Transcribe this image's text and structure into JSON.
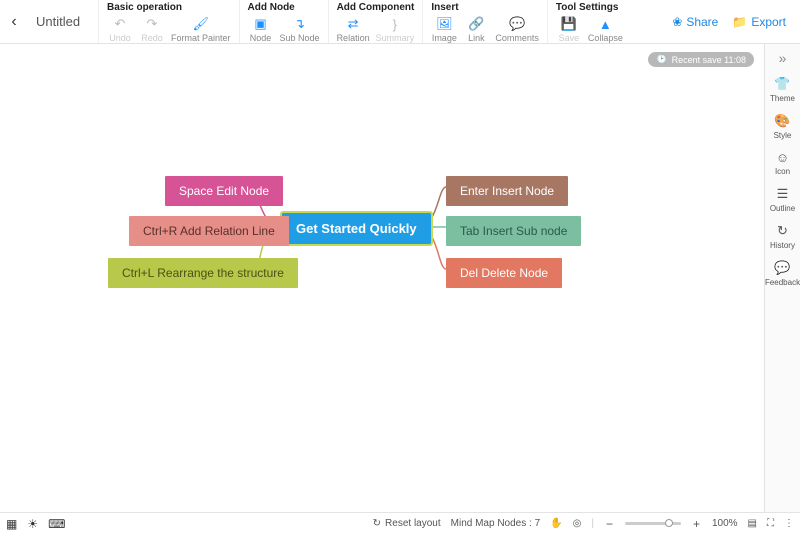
{
  "app": {
    "title": "Untitled"
  },
  "toolbar": {
    "groups": {
      "basic": {
        "label": "Basic operation",
        "undo": "Undo",
        "redo": "Redo",
        "fmt": "Format Painter"
      },
      "addnode": {
        "label": "Add Node",
        "node": "Node",
        "subnode": "Sub Node"
      },
      "addcomp": {
        "label": "Add Component",
        "relation": "Relation",
        "summary": "Summary"
      },
      "insert": {
        "label": "Insert",
        "image": "Image",
        "link": "Link",
        "comments": "Comments"
      },
      "toolset": {
        "label": "Tool Settings",
        "save": "Save",
        "collapse": "Collapse"
      }
    },
    "share": "Share",
    "export": "Export"
  },
  "savebadge": "Recent save 11:08",
  "sidebar": {
    "theme": "Theme",
    "style": "Style",
    "icon": "Icon",
    "outline": "Outline",
    "history": "History",
    "feedback": "Feedback"
  },
  "bottom": {
    "reset": "Reset layout",
    "nodes_label": "Mind Map Nodes :",
    "nodes_count": "7",
    "zoom": "100%"
  },
  "mindmap": {
    "center": "Get Started Quickly",
    "left": [
      {
        "text": "Space Edit Node",
        "color": "#d65396"
      },
      {
        "text": "Ctrl+R Add Relation Line",
        "color": "#e68f89"
      },
      {
        "text": "Ctrl+L Rearrange the structure",
        "color": "#b7c84a"
      }
    ],
    "right": [
      {
        "text": "Enter Insert Node",
        "color": "#a87764"
      },
      {
        "text": "Tab Insert Sub node",
        "color": "#7bbfa0"
      },
      {
        "text": "Del Delete Node",
        "color": "#e27861"
      }
    ]
  }
}
